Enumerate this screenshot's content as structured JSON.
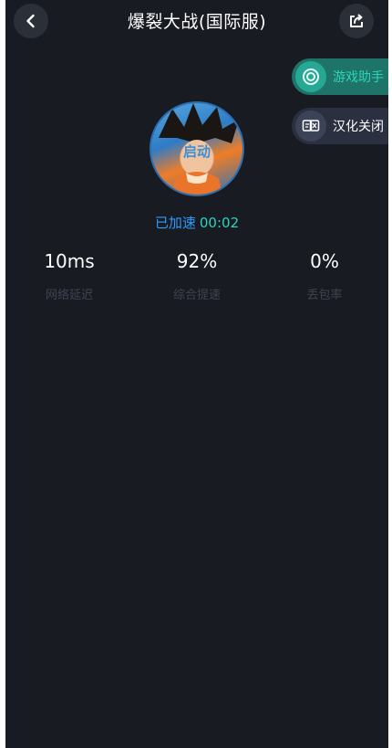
{
  "header": {
    "title": "爆裂大战(国际服)",
    "back_icon": "chevron-left-icon",
    "share_icon": "share-icon"
  },
  "side_buttons": {
    "game_assistant": {
      "label": "游戏助手",
      "icon": "assistant-ring-icon",
      "color": "#2fd3b6"
    },
    "localization": {
      "label": "汉化关闭",
      "icon": "translate-icon"
    }
  },
  "game": {
    "launch_label": "启动",
    "accelerated_label": "已加速",
    "accelerated_time": "00:02"
  },
  "stats": [
    {
      "value": "10ms",
      "label": "网络延迟"
    },
    {
      "value": "92%",
      "label": "综合提速"
    },
    {
      "value": "0%",
      "label": "丢包率"
    }
  ],
  "colors": {
    "background": "#181b22",
    "accent_teal": "#29d6c0",
    "accent_blue": "#2e9bff"
  }
}
